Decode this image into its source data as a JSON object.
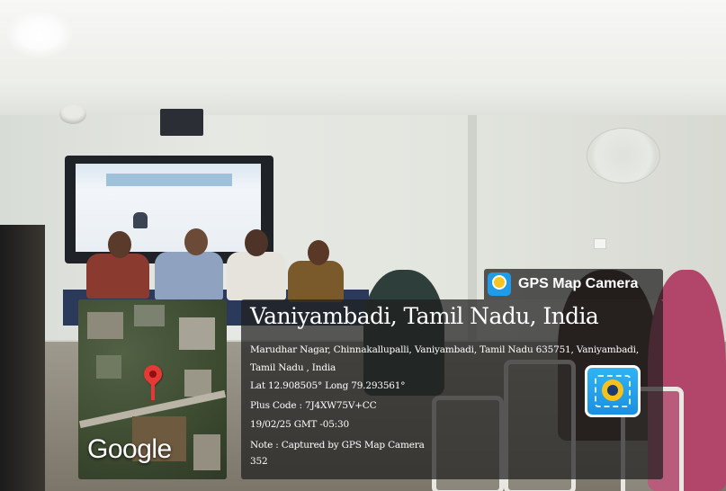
{
  "overlay": {
    "badge_label": "GPS Map Camera",
    "title": "Vaniyambadi, Tamil Nadu, India",
    "address_line1": "Marudhar Nagar, Chinnakallupalli, Vaniyambadi, Tamil Nadu 635751, Vaniyambadi,",
    "address_line2": "Tamil Nadu , India",
    "coordinates": "Lat 12.908505° Long 79.293561°",
    "plus_code": "Plus Code : 7J4XW75V+CC",
    "datetime": "19/02/25 GMT -05:30",
    "note": "Note : Captured by GPS Map Camera",
    "note_number": "352",
    "map_brand": "Google"
  },
  "colors": {
    "panel_bg": "#1e1e1e",
    "pin": "#e53935",
    "app_icon": "#1f9be8",
    "app_lens": "#f5c21a"
  },
  "icons": {
    "badge_icon": "gps-map-camera-logo-icon",
    "map_pin": "map-pin-icon",
    "app_logo": "gps-map-camera-app-icon"
  }
}
